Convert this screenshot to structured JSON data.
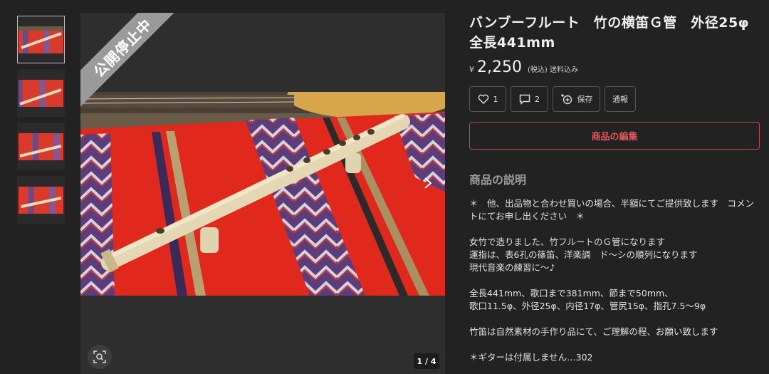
{
  "product": {
    "title": "バンブーフルート　竹の横笛Ｇ管　外径25φ　全長441mm",
    "currency": "¥",
    "price": "2,250",
    "tax_note": "(税込) 送料込み",
    "status_ribbon": "公開停止中",
    "image_counter": "1 / 4"
  },
  "actions": {
    "like_count": "1",
    "comment_count": "2",
    "save_label": "保存",
    "report_label": "通報",
    "edit_label": "商品の編集"
  },
  "description": {
    "heading": "商品の説明",
    "line1": "＊　他、出品物と合わせ買いの場合、半額にてご提供致します　コメントにてお申し出ください　＊",
    "line2": "女竹で造りました、竹フルートのＧ管になります",
    "line3": "運指は、表6孔の篠笛、洋楽調　ド～シの順列になります",
    "line4": "現代音楽の練習に～♪",
    "line5": "全長441mm、歌口まで381mm、節まで50mm、",
    "line6": "歌口11.5φ、外径25φ、内径17φ、管尻15φ、指孔7.5～9φ",
    "line7": "竹笛は自然素材の手作り品にて、ご理解の程、お願い致します",
    "line8": "＊ギターは付属しません…302"
  },
  "colors": {
    "background": "#222222",
    "accent_red": "#e1565c",
    "ribbon": "#9a9a9a"
  },
  "icons": {
    "like": "heart-icon",
    "comment": "comment-icon",
    "save": "save-add-icon",
    "zoom": "zoom-icon",
    "next": "chevron-right-icon"
  }
}
